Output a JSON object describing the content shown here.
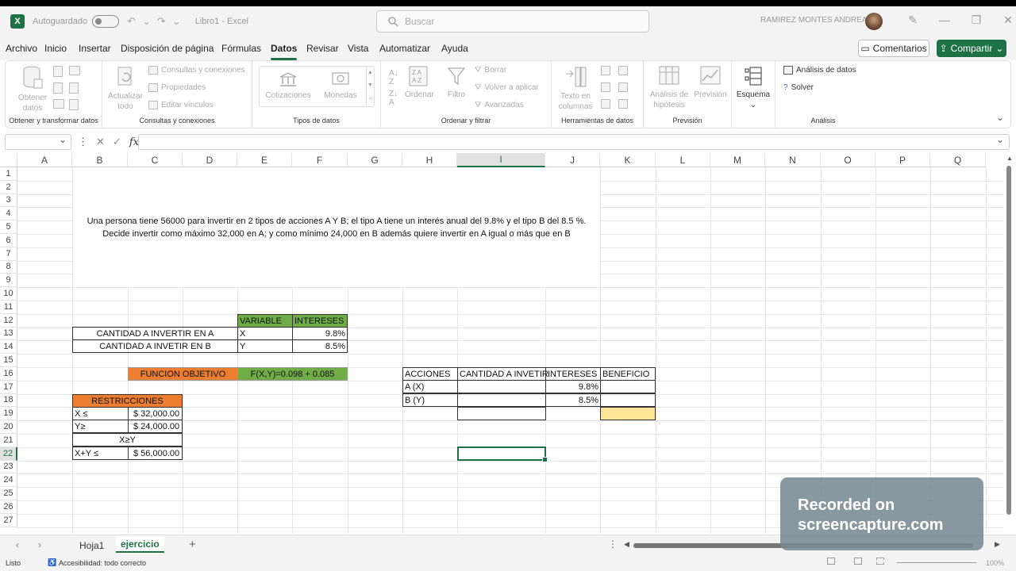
{
  "titlebar": {
    "app_icon": "X",
    "autosave": "Autoguardado",
    "file_name": "Libro1 - Excel",
    "search_placeholder": "Buscar",
    "user": "RAMIREZ MONTES ANDREA"
  },
  "menu": {
    "tabs": [
      "Archivo",
      "Inicio",
      "Insertar",
      "Disposición de página",
      "Fórmulas",
      "Datos",
      "Revisar",
      "Vista",
      "Automatizar",
      "Ayuda"
    ],
    "active": "Datos",
    "comments": "Comentarios",
    "share": "Compartir"
  },
  "ribbon": {
    "get_data": "Obtener datos",
    "get_transform": "Obtener y transformar datos",
    "refresh_all": "Actualizar todo",
    "queries_connections": "Consultas y conexiones",
    "properties": "Propiedades",
    "edit_links": "Editar vínculos",
    "queries_group": "Consultas y conexiones",
    "stocks": "Cotizaciones",
    "currencies": "Monedas",
    "data_types_group": "Tipos de datos",
    "sort": "Ordenar",
    "filter": "Filtro",
    "clear": "Borrar",
    "reapply": "Volver a aplicar",
    "advanced": "Avanzadas",
    "sort_filter_group": "Ordenar y filtrar",
    "text_to_columns": "Texto en columnas",
    "data_tools_group": "Herramientas de datos",
    "what_if": "Análisis de hipótesis",
    "forecast": "Previsión",
    "forecast_group": "Previsión",
    "outline": "Esquema",
    "data_analysis": "Análisis de datos",
    "solver": "Solver",
    "analysis_group": "Análisis"
  },
  "formula_bar": {
    "name_box": "",
    "fx": "fx",
    "formula": ""
  },
  "columns": [
    "A",
    "B",
    "C",
    "D",
    "E",
    "F",
    "G",
    "H",
    "I",
    "J",
    "K",
    "L",
    "M",
    "N",
    "O",
    "P",
    "Q"
  ],
  "selected_column": "I",
  "rows": [
    "1",
    "2",
    "3",
    "4",
    "5",
    "6",
    "7",
    "8",
    "9",
    "10",
    "11",
    "12",
    "13",
    "14",
    "15",
    "16",
    "17",
    "18",
    "19",
    "20",
    "21",
    "22",
    "23",
    "24",
    "25",
    "26",
    "27"
  ],
  "selected_row": "22",
  "problem_text": "Una persona tiene 56000 para invertir en 2 tipos de acciones A Y B; el tipo A tiene un interés anual del 9.8% y el tipo B del 8.5 %. Decide invertir como máximo 32,000 en A; y como mínimo 24,000 en B además quiere invertir en A igual o más que en B",
  "variables_table": {
    "headers": [
      "VARIABLE",
      "INTERESES"
    ],
    "rows": [
      {
        "label": "CANTIDAD A INVERTIR EN A",
        "var": "X",
        "rate": "9.8%"
      },
      {
        "label": "CANTIDAD A INVETIR EN B",
        "var": "Y",
        "rate": "8.5%"
      }
    ]
  },
  "objective": {
    "label": "FUNCION OBJETIVO",
    "formula": "F(X,Y)=0.098 + 0.085"
  },
  "restrictions": {
    "title": "RESTRICCIONES",
    "r1": {
      "left": "X ≤",
      "right": "$ 32,000.00"
    },
    "r2": {
      "left": "Y≥",
      "right": "$ 24,000.00"
    },
    "r3": "X≥Y",
    "r4": {
      "left": "X+Y ≤",
      "right": "$ 56,000.00"
    }
  },
  "actions_table": {
    "headers": [
      "ACCIONES",
      "CANTIDAD A INVETIR",
      "INTERESES",
      "BENEFICIO"
    ],
    "rows": [
      {
        "name": "A (X)",
        "amount": "",
        "rate": "9.8%",
        "benefit": ""
      },
      {
        "name": "B (Y)",
        "amount": "",
        "rate": "8.5%",
        "benefit": ""
      }
    ]
  },
  "sheets": {
    "tab1": "Hoja1",
    "tab2": "ejercicio",
    "active": "ejercicio"
  },
  "status": {
    "ready": "Listo",
    "accessibility": "Accesibilidad: todo correcto",
    "zoom": "100%"
  },
  "overlay": {
    "line1": "Recorded on",
    "line2": "screencapture.com"
  },
  "colors": {
    "excel_green": "#1e7145",
    "header_green": "#70ad47",
    "header_orange": "#ed7d31",
    "highlight_yellow": "#ffe699"
  }
}
